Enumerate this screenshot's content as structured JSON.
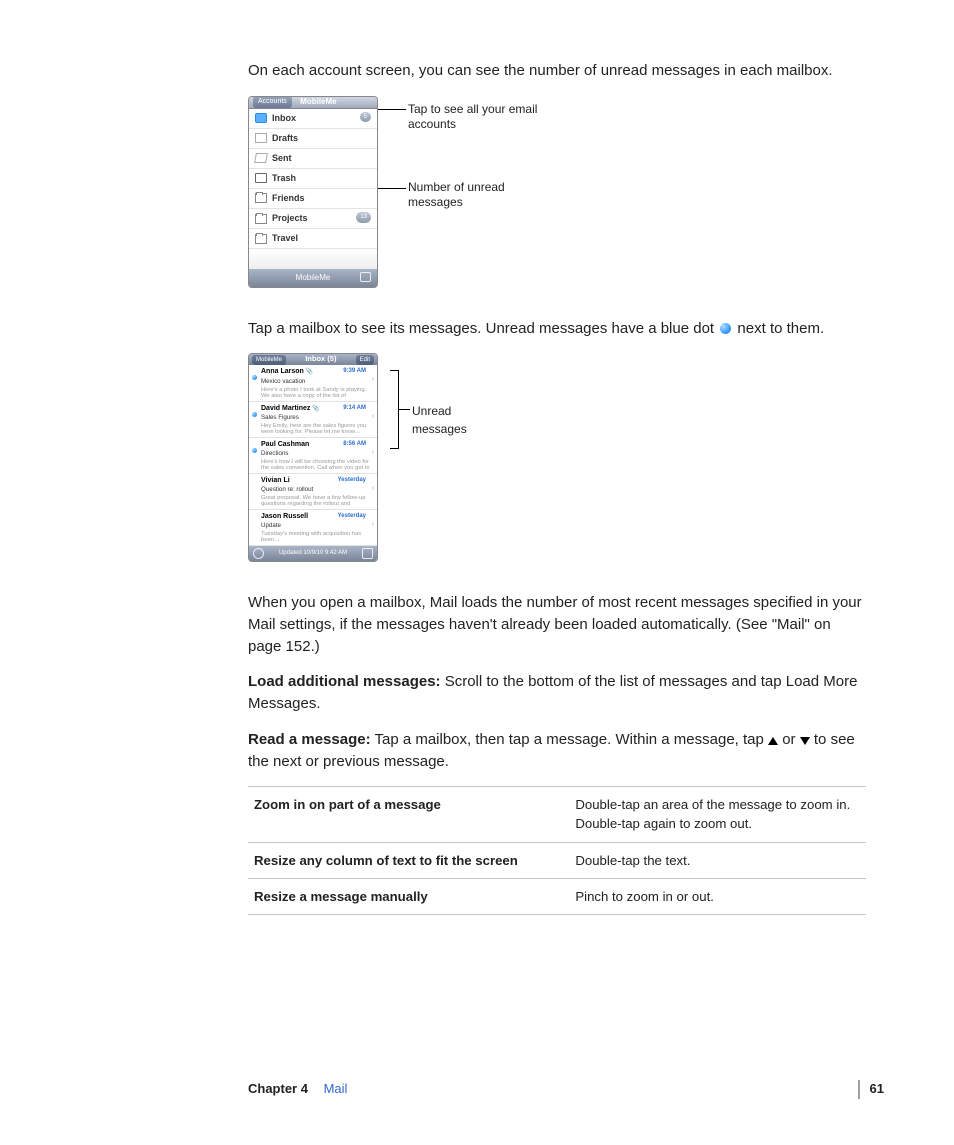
{
  "intro_line": "On each account screen, you can see the number of unread messages in each mailbox.",
  "accounts_mock": {
    "back_btn": "Accounts",
    "title": "MobileMe",
    "rows": [
      {
        "label": "Inbox",
        "icon": "inbox",
        "badge": "5"
      },
      {
        "label": "Drafts",
        "icon": "drafts"
      },
      {
        "label": "Sent",
        "icon": "sent"
      },
      {
        "label": "Trash",
        "icon": "trash"
      },
      {
        "label": "Friends",
        "icon": "folder"
      },
      {
        "label": "Projects",
        "icon": "folder",
        "badge": "13"
      },
      {
        "label": "Travel",
        "icon": "folder"
      }
    ],
    "footer_label": "MobileMe",
    "callout1": "Tap to see all your email accounts",
    "callout2": "Number of unread messages"
  },
  "dot_line_a": "Tap a mailbox to see its messages. Unread messages have a blue dot ",
  "dot_line_b": " next to them.",
  "inbox_mock": {
    "back_btn": "MobileMe",
    "title": "Inbox (5)",
    "edit_btn": "Edit",
    "callout": "Unread messages",
    "footer_status": "Updated 10/9/10 9:42 AM",
    "messages": [
      {
        "from": "Anna Larson",
        "att": true,
        "time": "9:39 AM",
        "subject": "Mexico vacation",
        "preview": "Here's a photo I took at Sandy is playing. We also have a copy of the list of activity…",
        "unread": true
      },
      {
        "from": "David Martinez",
        "att": true,
        "time": "9:14 AM",
        "subject": "Sales Figures",
        "preview": "Hey Emily, here are the sales figures you were looking for. Please let me know…",
        "unread": true
      },
      {
        "from": "Paul Cashman",
        "att": false,
        "time": "8:56 AM",
        "subject": "Directions",
        "preview": "Here's how I will be choosing the video for the sales convention. Call when you get to the…",
        "unread": true
      },
      {
        "from": "Vivian Li",
        "att": false,
        "time": "Yesterday",
        "subject": "Question re: rollout",
        "preview": "Great proposal. We have a few follow-up questions regarding the rollout and would…",
        "unread": false
      },
      {
        "from": "Jason Russell",
        "att": false,
        "time": "Yesterday",
        "subject": "Update",
        "preview": "Tuesday's meeting with acquisition has been…",
        "unread": false
      }
    ]
  },
  "para_load_intro": "When you open a mailbox, Mail loads the number of most recent messages specified in your Mail settings, if the messages haven't already been loaded automatically. (See \"Mail\" on page 152.)",
  "load_more_label": "Load additional messages:",
  "load_more_body": "  Scroll to the bottom of the list of messages and tap Load More Messages.",
  "read_label": "Read a message:",
  "read_body_a": "  Tap a mailbox, then tap a message. Within a message, tap ",
  "read_body_mid": " or ",
  "read_body_b": " to see the next or previous message.",
  "table_rows": [
    {
      "action": "Zoom in on part of a message",
      "desc": "Double-tap an area of the message to zoom in. Double-tap again to zoom out."
    },
    {
      "action": "Resize any column of text to fit the screen",
      "desc": "Double-tap the text."
    },
    {
      "action": "Resize a message manually",
      "desc": "Pinch to zoom in or out."
    }
  ],
  "footer": {
    "chapter": "Chapter 4",
    "title": "Mail",
    "page": "61"
  }
}
